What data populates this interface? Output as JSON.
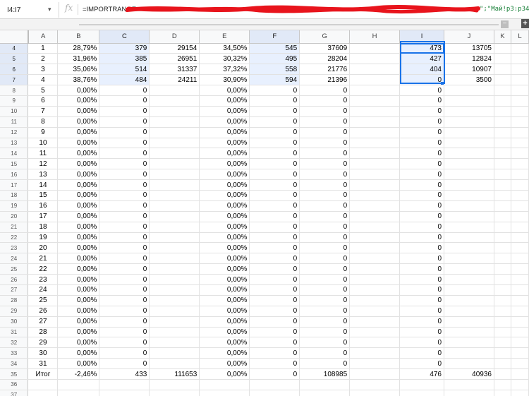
{
  "formula_bar": {
    "cell_ref": "I4:I7",
    "fx_label": "fx",
    "formula_start": "=IMPORTRANGE",
    "formula_end": "\";\"Май!p3:p34"
  },
  "columns": [
    "A",
    "B",
    "C",
    "D",
    "E",
    "F",
    "G",
    "H",
    "I",
    "J",
    "K",
    "L"
  ],
  "selected_columns": [
    "C",
    "F",
    "I"
  ],
  "selected_rows": [
    "4",
    "5",
    "6",
    "7"
  ],
  "rows": [
    {
      "n": "4",
      "cells": [
        "1",
        "28,79%",
        "379",
        "29154",
        "34,50%",
        "545",
        "37609",
        "",
        "473",
        "13705",
        "",
        ""
      ]
    },
    {
      "n": "5",
      "cells": [
        "2",
        "31,96%",
        "385",
        "26951",
        "30,32%",
        "495",
        "28204",
        "",
        "427",
        "12824",
        "",
        ""
      ]
    },
    {
      "n": "6",
      "cells": [
        "3",
        "35,06%",
        "514",
        "31337",
        "37,32%",
        "558",
        "21776",
        "",
        "404",
        "10907",
        "",
        ""
      ]
    },
    {
      "n": "7",
      "cells": [
        "4",
        "38,76%",
        "484",
        "24211",
        "30,90%",
        "594",
        "21396",
        "",
        "0",
        "3500",
        "",
        ""
      ]
    },
    {
      "n": "8",
      "cells": [
        "5",
        "0,00%",
        "0",
        "",
        "0,00%",
        "0",
        "0",
        "",
        "0",
        "",
        "",
        ""
      ]
    },
    {
      "n": "9",
      "cells": [
        "6",
        "0,00%",
        "0",
        "",
        "0,00%",
        "0",
        "0",
        "",
        "0",
        "",
        "",
        ""
      ]
    },
    {
      "n": "10",
      "cells": [
        "7",
        "0,00%",
        "0",
        "",
        "0,00%",
        "0",
        "0",
        "",
        "0",
        "",
        "",
        ""
      ]
    },
    {
      "n": "11",
      "cells": [
        "8",
        "0,00%",
        "0",
        "",
        "0,00%",
        "0",
        "0",
        "",
        "0",
        "",
        "",
        ""
      ]
    },
    {
      "n": "12",
      "cells": [
        "9",
        "0,00%",
        "0",
        "",
        "0,00%",
        "0",
        "0",
        "",
        "0",
        "",
        "",
        ""
      ]
    },
    {
      "n": "13",
      "cells": [
        "10",
        "0,00%",
        "0",
        "",
        "0,00%",
        "0",
        "0",
        "",
        "0",
        "",
        "",
        ""
      ]
    },
    {
      "n": "14",
      "cells": [
        "11",
        "0,00%",
        "0",
        "",
        "0,00%",
        "0",
        "0",
        "",
        "0",
        "",
        "",
        ""
      ]
    },
    {
      "n": "15",
      "cells": [
        "12",
        "0,00%",
        "0",
        "",
        "0,00%",
        "0",
        "0",
        "",
        "0",
        "",
        "",
        ""
      ]
    },
    {
      "n": "16",
      "cells": [
        "13",
        "0,00%",
        "0",
        "",
        "0,00%",
        "0",
        "0",
        "",
        "0",
        "",
        "",
        ""
      ]
    },
    {
      "n": "17",
      "cells": [
        "14",
        "0,00%",
        "0",
        "",
        "0,00%",
        "0",
        "0",
        "",
        "0",
        "",
        "",
        ""
      ]
    },
    {
      "n": "18",
      "cells": [
        "15",
        "0,00%",
        "0",
        "",
        "0,00%",
        "0",
        "0",
        "",
        "0",
        "",
        "",
        ""
      ]
    },
    {
      "n": "19",
      "cells": [
        "16",
        "0,00%",
        "0",
        "",
        "0,00%",
        "0",
        "0",
        "",
        "0",
        "",
        "",
        ""
      ]
    },
    {
      "n": "20",
      "cells": [
        "17",
        "0,00%",
        "0",
        "",
        "0,00%",
        "0",
        "0",
        "",
        "0",
        "",
        "",
        ""
      ]
    },
    {
      "n": "21",
      "cells": [
        "18",
        "0,00%",
        "0",
        "",
        "0,00%",
        "0",
        "0",
        "",
        "0",
        "",
        "",
        ""
      ]
    },
    {
      "n": "22",
      "cells": [
        "19",
        "0,00%",
        "0",
        "",
        "0,00%",
        "0",
        "0",
        "",
        "0",
        "",
        "",
        ""
      ]
    },
    {
      "n": "23",
      "cells": [
        "20",
        "0,00%",
        "0",
        "",
        "0,00%",
        "0",
        "0",
        "",
        "0",
        "",
        "",
        ""
      ]
    },
    {
      "n": "24",
      "cells": [
        "21",
        "0,00%",
        "0",
        "",
        "0,00%",
        "0",
        "0",
        "",
        "0",
        "",
        "",
        ""
      ]
    },
    {
      "n": "25",
      "cells": [
        "22",
        "0,00%",
        "0",
        "",
        "0,00%",
        "0",
        "0",
        "",
        "0",
        "",
        "",
        ""
      ]
    },
    {
      "n": "26",
      "cells": [
        "23",
        "0,00%",
        "0",
        "",
        "0,00%",
        "0",
        "0",
        "",
        "0",
        "",
        "",
        ""
      ]
    },
    {
      "n": "27",
      "cells": [
        "24",
        "0,00%",
        "0",
        "",
        "0,00%",
        "0",
        "0",
        "",
        "0",
        "",
        "",
        ""
      ]
    },
    {
      "n": "28",
      "cells": [
        "25",
        "0,00%",
        "0",
        "",
        "0,00%",
        "0",
        "0",
        "",
        "0",
        "",
        "",
        ""
      ]
    },
    {
      "n": "29",
      "cells": [
        "26",
        "0,00%",
        "0",
        "",
        "0,00%",
        "0",
        "0",
        "",
        "0",
        "",
        "",
        ""
      ]
    },
    {
      "n": "30",
      "cells": [
        "27",
        "0,00%",
        "0",
        "",
        "0,00%",
        "0",
        "0",
        "",
        "0",
        "",
        "",
        ""
      ]
    },
    {
      "n": "31",
      "cells": [
        "28",
        "0,00%",
        "0",
        "",
        "0,00%",
        "0",
        "0",
        "",
        "0",
        "",
        "",
        ""
      ]
    },
    {
      "n": "32",
      "cells": [
        "29",
        "0,00%",
        "0",
        "",
        "0,00%",
        "0",
        "0",
        "",
        "0",
        "",
        "",
        ""
      ]
    },
    {
      "n": "33",
      "cells": [
        "30",
        "0,00%",
        "0",
        "",
        "0,00%",
        "0",
        "0",
        "",
        "0",
        "",
        "",
        ""
      ]
    },
    {
      "n": "34",
      "cells": [
        "31",
        "0,00%",
        "0",
        "",
        "0,00%",
        "0",
        "0",
        "",
        "0",
        "",
        "",
        ""
      ]
    },
    {
      "n": "35",
      "cells": [
        "Итог",
        "-2,46%",
        "433",
        "111653",
        "0,00%",
        "0",
        "108985",
        "",
        "476",
        "40936",
        "",
        ""
      ]
    },
    {
      "n": "36",
      "cells": [
        "",
        "",
        "",
        "",
        "",
        "",
        "",
        "",
        "",
        "",
        "",
        ""
      ]
    },
    {
      "n": "37",
      "cells": [
        "",
        "",
        "",
        "",
        "",
        "",
        "",
        "",
        "",
        "",
        "",
        ""
      ]
    }
  ],
  "colors": {
    "selection_border": "#1a73e8",
    "selection_fill": "#e8f0fe",
    "redaction": "#e8141c",
    "formula_range_text": "#188038"
  }
}
